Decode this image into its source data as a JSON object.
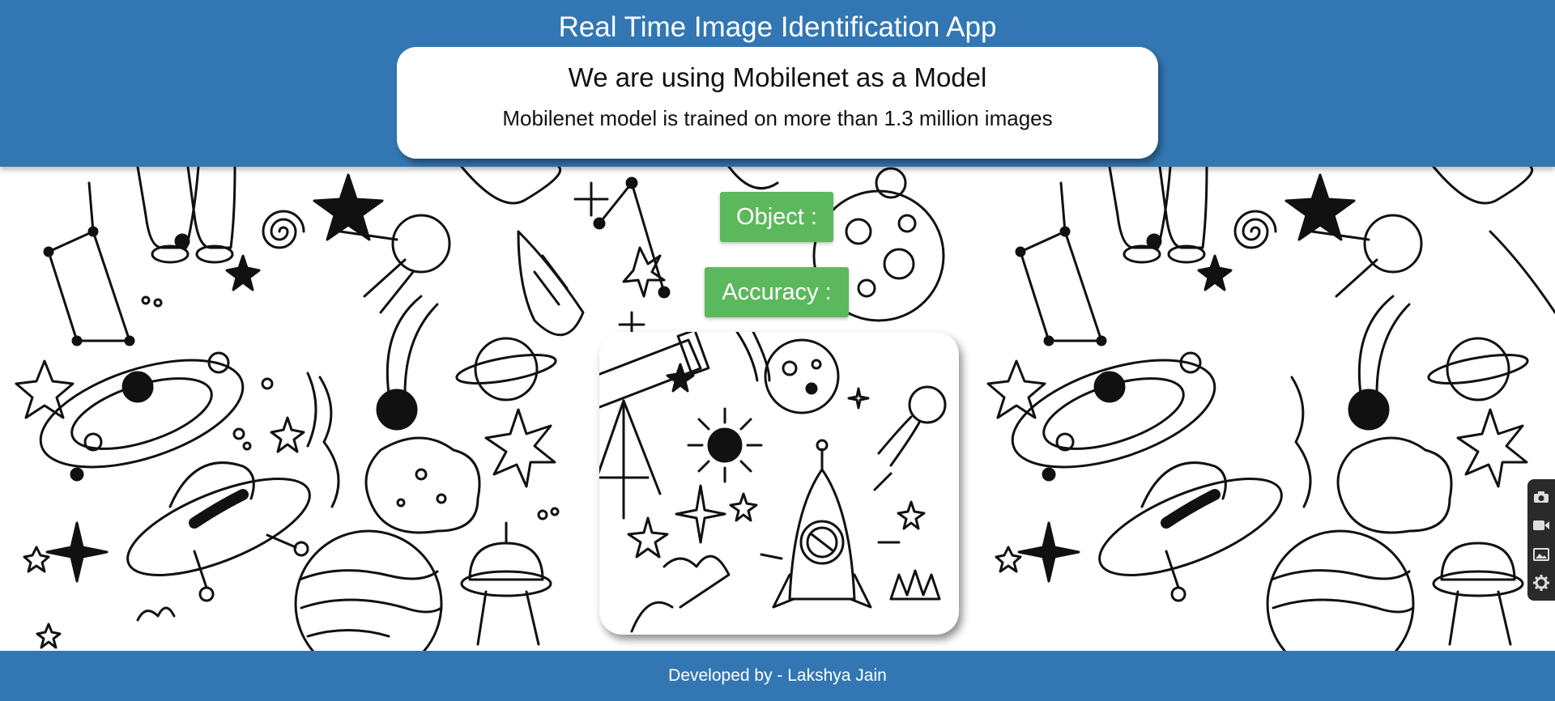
{
  "header": {
    "title": "Real Time Image Identification App",
    "card_heading": "We are using Mobilenet as a Model",
    "card_subtitle": "Mobilenet model is trained on more than 1.3 million images",
    "background_color": "#3277b3"
  },
  "prediction": {
    "object_label": "Object :",
    "accuracy_label": "Accuracy :",
    "button_color": "#5cb85c"
  },
  "background": {
    "description_icons": [
      "astronaut-icon",
      "rocket-icon",
      "planet-icon",
      "ufo-icon",
      "star-icon",
      "comet-icon",
      "telescope-icon",
      "constellation-icon"
    ]
  },
  "toolbar": {
    "tools": [
      "camera-icon",
      "video-icon",
      "image-icon",
      "gear-icon"
    ]
  },
  "footer": {
    "credit": "Developed by - Lakshya Jain"
  }
}
